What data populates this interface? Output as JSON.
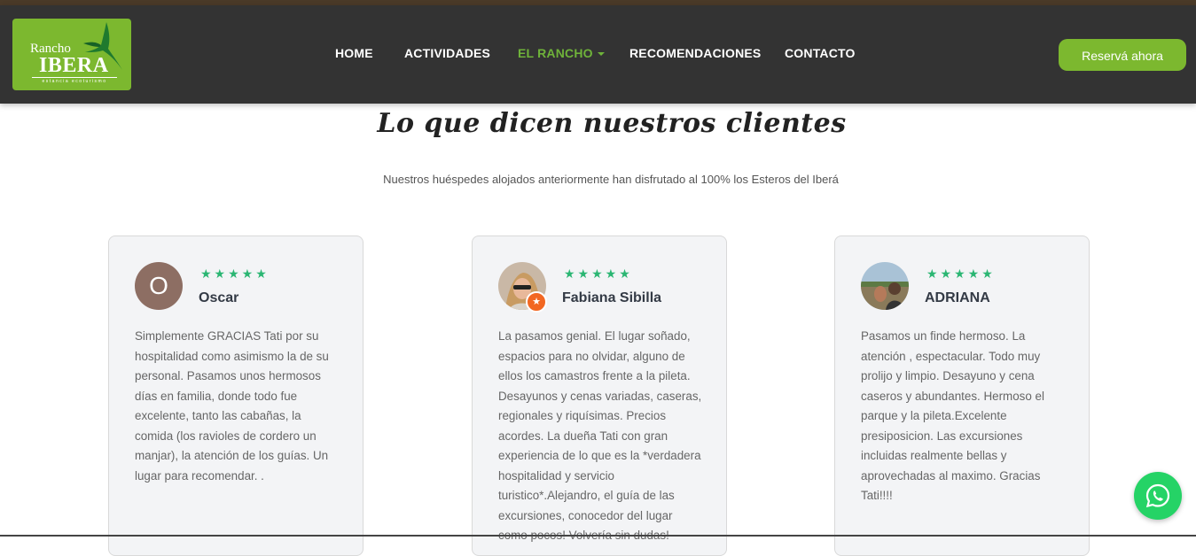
{
  "brand": {
    "line1": "Rancho",
    "line2": "IBERA",
    "tagline": "estancia ecoturismo",
    "color": "#7cb82f"
  },
  "nav": {
    "items": [
      {
        "label": "HOME"
      },
      {
        "label": "ACTIVIDADES"
      },
      {
        "label": "EL RANCHO",
        "active": true
      },
      {
        "label": "RECOMENDACIONES"
      },
      {
        "label": "CONTACTO"
      }
    ],
    "reserve_label": "Reservá ahora",
    "active_color": "#6fb33a"
  },
  "section": {
    "heading": "Lo que dicen nuestros clientes",
    "subheading": "Nuestros huéspedes alojados anteriormente han disfrutado al 100% los Esteros del Iberá"
  },
  "reviews": [
    {
      "initial": "O",
      "avatar_type": "letter",
      "stars": "★★★★★",
      "name": "Oscar",
      "text": "Simplemente GRACIAS Tati por su hospitalidad como asimismo la de su personal. Pasamos unos hermosos días en familia, donde todo fue excelente, tanto las cabañas, la comida (los ravioles de cordero un manjar), la atención de los guías. Un lugar para recomendar. ."
    },
    {
      "avatar_type": "photo",
      "badge": "★",
      "stars": "★★★★★",
      "name": "Fabiana Sibilla",
      "text": "La pasamos genial. El lugar soñado, espacios para no olvidar, alguno de ellos los camastros frente a la pileta. Desayunos y cenas variadas, caseras, regionales y riquísimas. Precios acordes. La dueña Tati con gran experiencia de lo que es la *verdadera hospitalidad y servicio turistico*.Alejandro, el guía de las excursiones, conocedor del lugar como pocos! Volvería sin dudas!"
    },
    {
      "avatar_type": "photo",
      "stars": "★★★★★",
      "name": "ADRIANA",
      "text": "Pasamos un finde hermoso. La atención , espectacular. Todo muy prolijo y limpio. Desayuno y cena caseros y abundantes. Hermoso el parque y la pileta.Excelente presiposicion. Las excursiones incluidas realmente bellas y aprovechadas al maximo. Gracias Tati!!!!"
    }
  ],
  "colors": {
    "navbar": "#333333",
    "star": "#2bb673",
    "whatsapp": "#25d366"
  },
  "icons": {
    "whatsapp": "whatsapp-icon"
  }
}
